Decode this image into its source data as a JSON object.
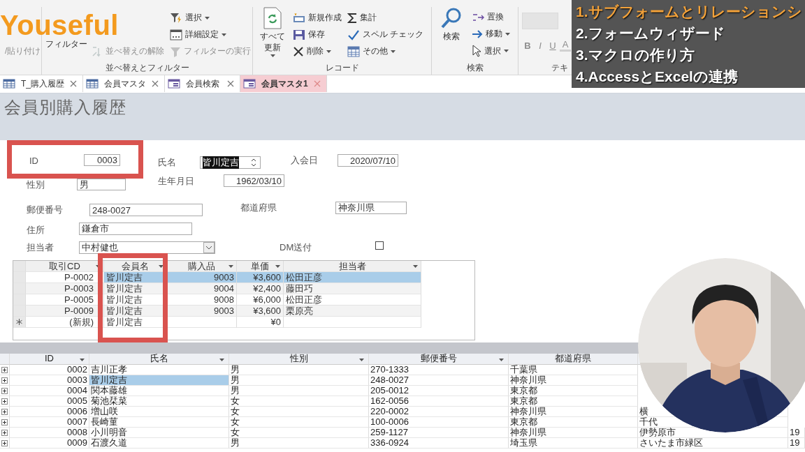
{
  "ribbon": {
    "groups": [
      {
        "columns": [
          [
            {
              "label": "/貼り付け",
              "dropdown": false,
              "disabled": true
            }
          ]
        ]
      },
      {
        "label": "並べ替えとフィルター",
        "columns": [
          [
            {
              "label": "フィルター",
              "dropdown": false,
              "disabled": false
            }
          ],
          [
            {
              "label": "並べ替えの解除",
              "dropdown": false,
              "disabled": true
            }
          ],
          [
            {
              "label": "選択",
              "dropdown": true,
              "disabled": false
            },
            {
              "label": "詳細設定",
              "dropdown": true,
              "disabled": false
            },
            {
              "label": "フィルターの実行",
              "dropdown": false,
              "disabled": true
            }
          ]
        ]
      },
      {
        "label": "レコード",
        "columns": [
          [
            {
              "label": "すべて更新",
              "dropdown": true,
              "disabled": false
            }
          ],
          [
            {
              "label": "新規作成",
              "dropdown": false,
              "disabled": false
            },
            {
              "label": "保存",
              "dropdown": false,
              "disabled": false
            },
            {
              "label": "削除",
              "dropdown": true,
              "disabled": false
            }
          ],
          [
            {
              "label": "集計",
              "dropdown": false,
              "disabled": false
            },
            {
              "label": "スペル チェック",
              "dropdown": false,
              "disabled": false
            },
            {
              "label": "その他",
              "dropdown": true,
              "disabled": false
            }
          ]
        ]
      },
      {
        "label": "検索",
        "columns": [
          [
            {
              "label": "検索",
              "dropdown": false,
              "disabled": false
            }
          ],
          [
            {
              "label": "置換",
              "dropdown": false,
              "disabled": false
            },
            {
              "label": "移動",
              "dropdown": true,
              "disabled": false
            },
            {
              "label": "選択",
              "dropdown": true,
              "disabled": false
            }
          ]
        ]
      },
      {
        "label": "テキ",
        "format_buttons": [
          {
            "label": "B",
            "kind": "bold",
            "disabled": true
          },
          {
            "label": "I",
            "kind": "italic",
            "disabled": true
          },
          {
            "label": "U",
            "kind": "underline",
            "disabled": true
          },
          {
            "label": "A",
            "kind": "color",
            "disabled": true
          }
        ]
      }
    ]
  },
  "logo": "Youseful",
  "topics": [
    {
      "text": "1.サブフォームとリレーションシ",
      "current": true
    },
    {
      "text": "2.フォームウィザード",
      "current": false
    },
    {
      "text": "3.マクロの作り方",
      "current": false
    },
    {
      "text": "4.AccessとExcelの連携",
      "current": false
    }
  ],
  "tabs": [
    {
      "label": "T_購入履歴",
      "kind": "table",
      "selected": false
    },
    {
      "label": "会員マスタ",
      "kind": "table",
      "selected": false
    },
    {
      "label": "会員検索",
      "kind": "form",
      "selected": false
    },
    {
      "label": "会員マスタ1",
      "kind": "form",
      "selected": true
    }
  ],
  "form": {
    "title": "会員別購入履歴",
    "fields": [
      {
        "label": "ID",
        "kind": "text",
        "value": "0003",
        "text_selected": false
      },
      {
        "label": "氏名",
        "kind": "spin",
        "value": "皆川定吉",
        "text_selected": true
      },
      {
        "label": "入会日",
        "kind": "text",
        "value": "2020/07/10",
        "text_selected": false
      },
      {
        "label": "性別",
        "kind": "text",
        "value": "男",
        "text_selected": false
      },
      {
        "label": "生年月日",
        "kind": "text",
        "value": "1962/03/10",
        "text_selected": false
      },
      {
        "label": "郵便番号",
        "kind": "text",
        "value": "248-0027",
        "text_selected": false
      },
      {
        "label": "都道府県",
        "kind": "text",
        "value": "神奈川県",
        "text_selected": false
      },
      {
        "label": "住所",
        "kind": "text",
        "value": "鎌倉市",
        "text_selected": false
      },
      {
        "label": "担当者",
        "kind": "combo",
        "value": "中村健也",
        "text_selected": false
      },
      {
        "label": "DM送付",
        "kind": "checkbox",
        "checked": false
      }
    ],
    "subform": {
      "columns": [
        "取引CD",
        "会員名",
        "購入品",
        "単価",
        "担当者"
      ],
      "rows": [
        {
          "kind": "record",
          "selected": true,
          "cells": [
            "P-0002",
            "皆川定吉",
            "9003",
            "¥3,600",
            "松田正彦"
          ]
        },
        {
          "kind": "record",
          "selected": false,
          "cells": [
            "P-0003",
            "皆川定吉",
            "9004",
            "¥2,400",
            "藤田巧"
          ]
        },
        {
          "kind": "record",
          "selected": false,
          "cells": [
            "P-0005",
            "皆川定吉",
            "9008",
            "¥6,000",
            "松田正彦"
          ]
        },
        {
          "kind": "record",
          "selected": false,
          "cells": [
            "P-0009",
            "皆川定吉",
            "9003",
            "¥3,600",
            "栗原亮"
          ]
        },
        {
          "kind": "new",
          "selected": false,
          "cells": [
            "(新規)",
            "皆川定吉",
            null,
            "¥0",
            null
          ]
        }
      ]
    }
  },
  "datasheet": {
    "columns": [
      {
        "label": "ID",
        "filter": true
      },
      {
        "label": "氏名",
        "filter": true
      },
      {
        "label": "性別",
        "filter": true
      },
      {
        "label": "郵便番号",
        "filter": true
      },
      {
        "label": "都道府県",
        "filter": false
      }
    ],
    "rows": [
      {
        "selected": false,
        "cells": [
          "0002",
          "吉川正孝",
          "男",
          "270-1333",
          "千葉県"
        ]
      },
      {
        "selected": true,
        "cells": [
          "0003",
          "皆川定吉",
          "男",
          "248-0027",
          "神奈川県"
        ]
      },
      {
        "selected": false,
        "cells": [
          "0004",
          "関本藤雄",
          "男",
          "205-0012",
          "東京都"
        ]
      },
      {
        "selected": false,
        "cells": [
          "0005",
          "菊池栞菜",
          "女",
          "162-0056",
          "東京都"
        ]
      },
      {
        "selected": false,
        "cells": [
          "0006",
          "増山咲",
          "女",
          "220-0002",
          "神奈川県"
        ],
        "column_6": "横"
      },
      {
        "selected": false,
        "cells": [
          "0007",
          "長崎菫",
          "女",
          "100-0006",
          "東京都"
        ],
        "column_6": "千代"
      },
      {
        "selected": false,
        "cells": [
          "0008",
          "小川明音",
          "女",
          "259-1127",
          "神奈川県"
        ],
        "column_6": "伊勢原市",
        "column_7": "19"
      },
      {
        "selected": false,
        "cells": [
          "0009",
          "石渡久道",
          "男",
          "336-0924",
          "埼玉県"
        ],
        "column_6": "さいたま市緑区",
        "column_7": "19"
      }
    ]
  }
}
